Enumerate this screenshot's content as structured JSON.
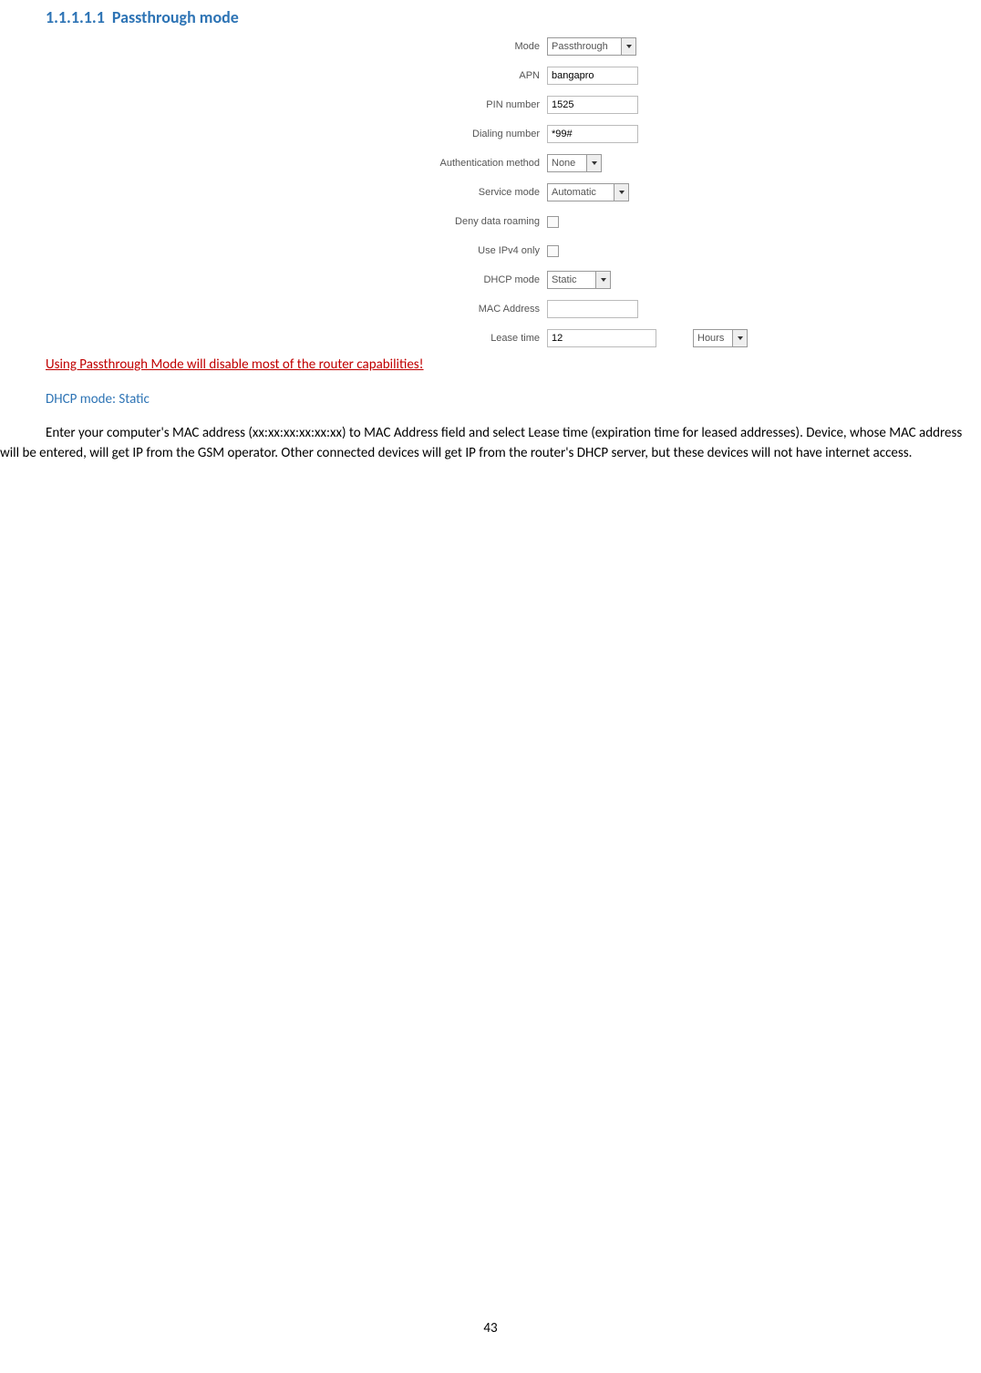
{
  "heading": {
    "number": "1.1.1.1.1",
    "title": "Passthrough mode"
  },
  "form": {
    "mode": {
      "label": "Mode",
      "value": "Passthrough"
    },
    "apn": {
      "label": "APN",
      "value": "bangapro"
    },
    "pin": {
      "label": "PIN number",
      "value": "1525"
    },
    "dialing": {
      "label": "Dialing number",
      "value": "*99#"
    },
    "auth": {
      "label": "Authentication method",
      "value": "None"
    },
    "service": {
      "label": "Service mode",
      "value": "Automatic"
    },
    "roaming": {
      "label": "Deny data roaming"
    },
    "ipv4": {
      "label": "Use IPv4 only"
    },
    "dhcp": {
      "label": "DHCP mode",
      "value": "Static"
    },
    "mac": {
      "label": "MAC Address",
      "value": ""
    },
    "lease": {
      "label": "Lease time",
      "value": "12",
      "unit": "Hours"
    }
  },
  "warning": "Using Passthrough Mode will disable most of the router capabilities!",
  "subheading": "DHCP mode: Static",
  "body": "Enter your computer's MAC address (xx:xx:xx:xx:xx:xx) to MAC Address field and select Lease time (expiration time for leased addresses). Device, whose MAC address will be entered, will get IP from the GSM operator. Other connected devices will get IP from the router's DHCP server, but these devices will not have internet access.",
  "pageNumber": "43"
}
